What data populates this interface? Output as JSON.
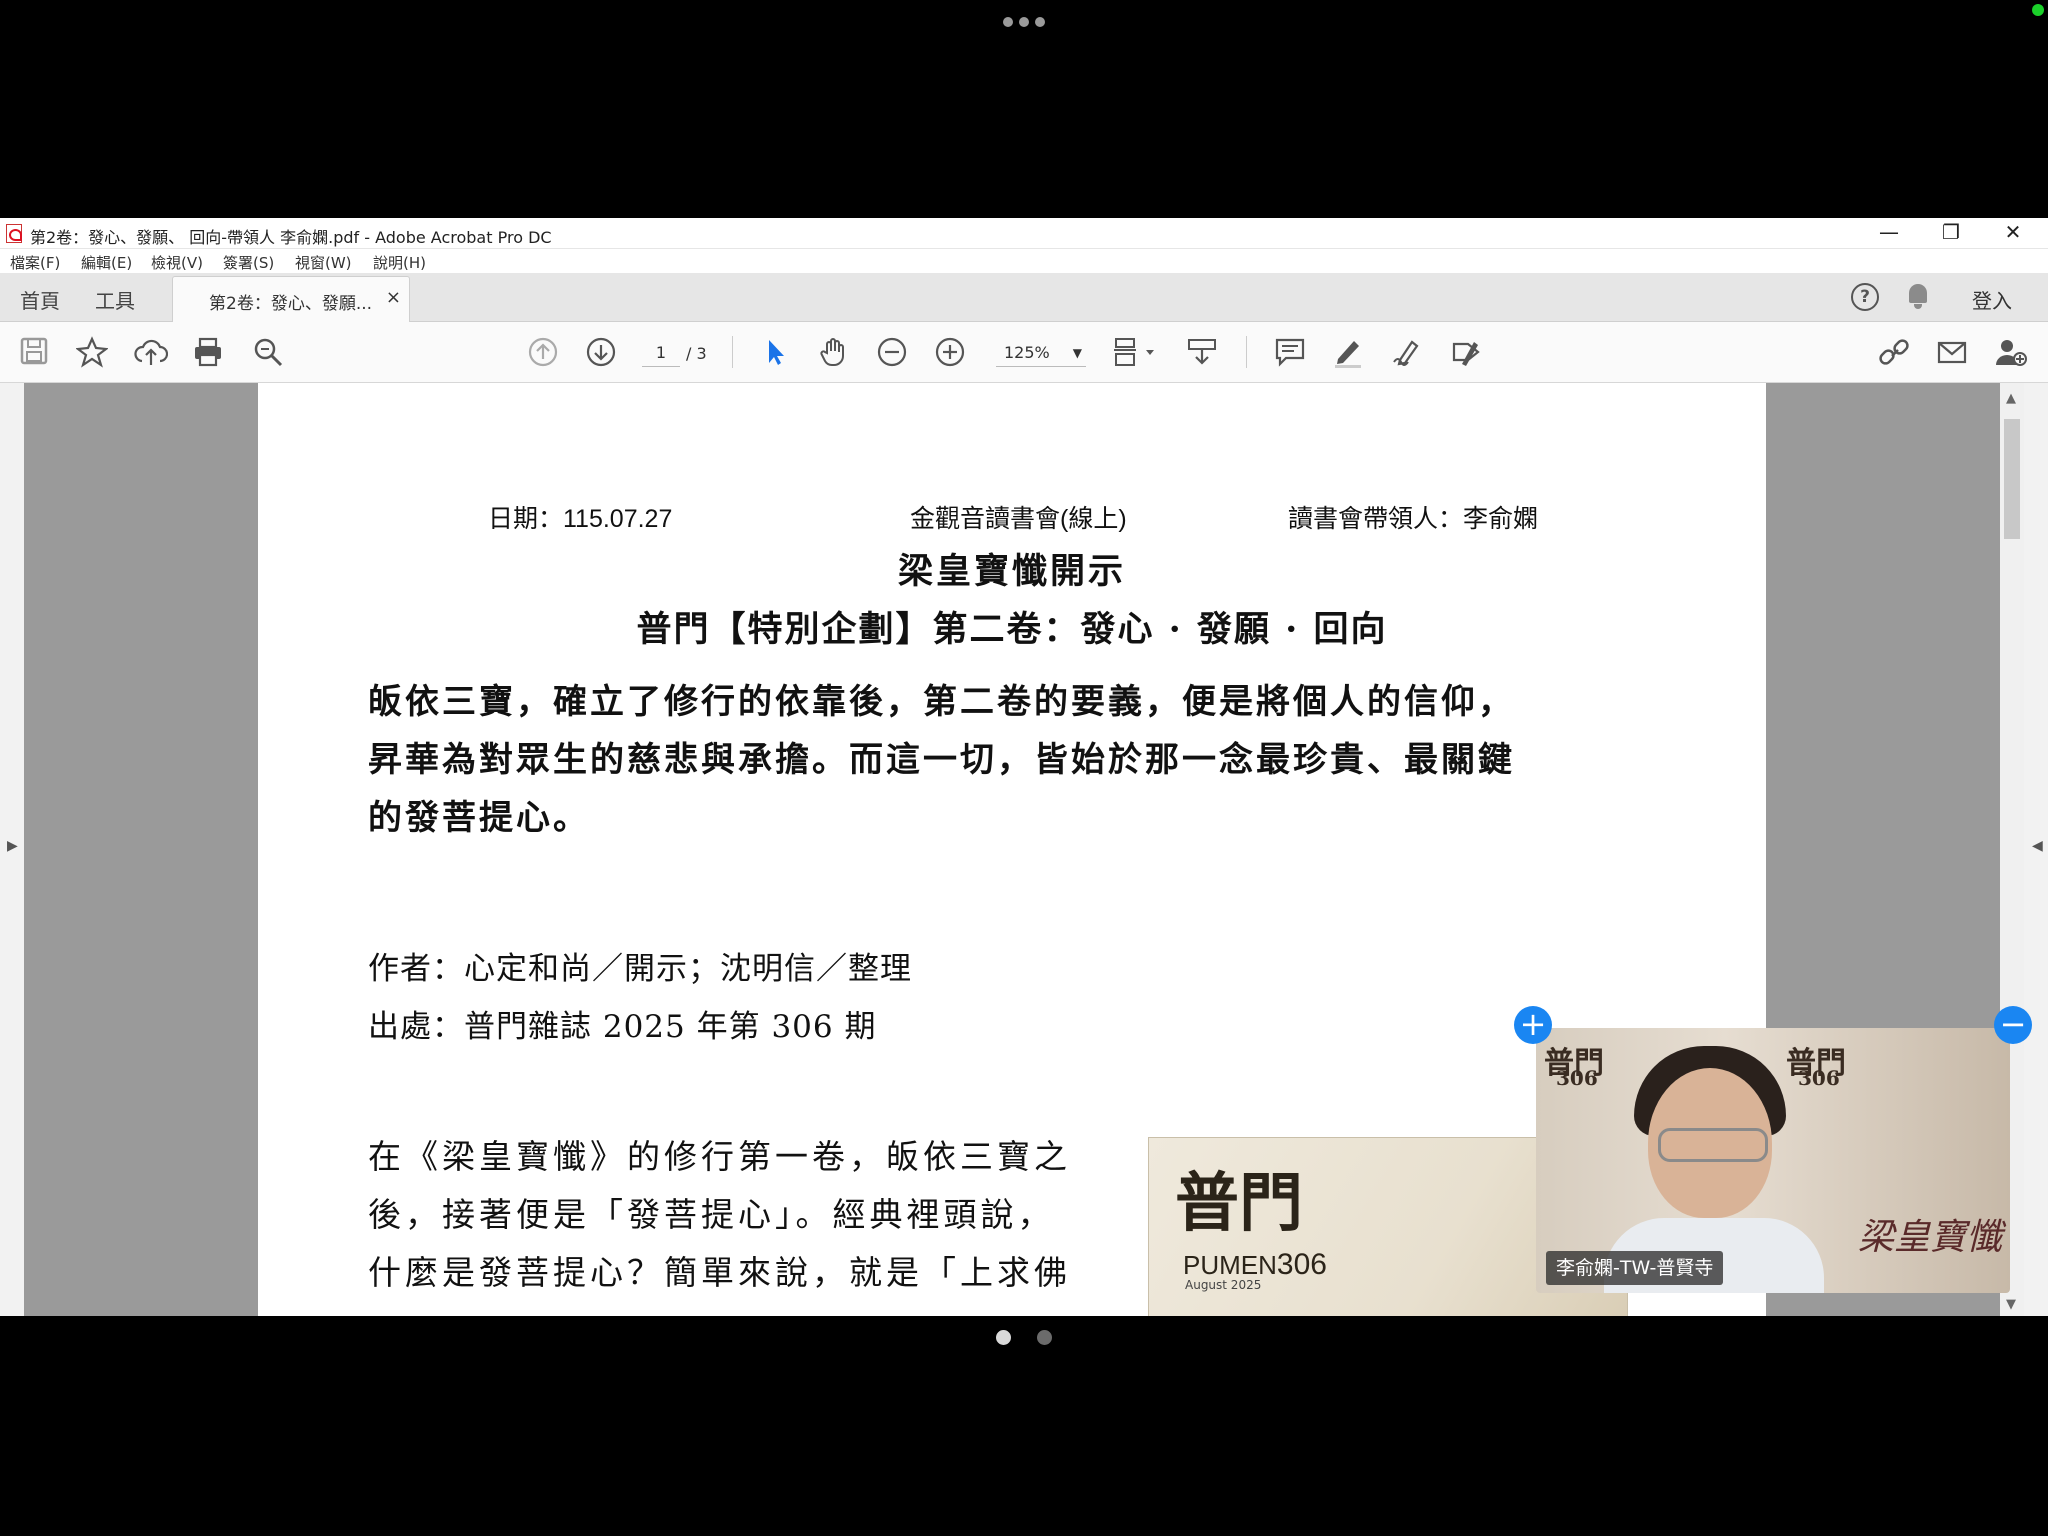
{
  "window": {
    "title": "第2卷：發心、發願、 回向-帶領人 李俞嫻.pdf - Adobe Acrobat Pro DC",
    "minimize": "—",
    "restore": "❐",
    "close": "✕"
  },
  "menu": [
    "檔案(F)",
    "編輯(E)",
    "檢視(V)",
    "簽署(S)",
    "視窗(W)",
    "說明(H)"
  ],
  "tabs": {
    "home": "首頁",
    "tools": "工具",
    "document": "第2卷：發心、發願...",
    "close": "×",
    "help": "?",
    "login": "登入"
  },
  "toolbar": {
    "current_page": "1",
    "total_pages": "/ 3",
    "zoom": "125%"
  },
  "document": {
    "date": "日期：115.07.27",
    "event": "金觀音讀書會(線上)",
    "leader": "讀書會帶領人：李俞嫻",
    "title1": "梁皇寶懺開示",
    "title2": "普門【特別企劃】第二卷：發心 · 發願 · 回向",
    "lead_line1": "皈依三寶，確立了修行的依靠後，第二卷的要義，便是將個人的信仰，",
    "lead_line2": "昇華為對眾生的慈悲與承擔。而這一切，皆始於那一念最珍貴、最關鍵",
    "lead_line3": "的發菩提心。",
    "author": "作者：心定和尚／開示；沈明信／整理",
    "source": "出處：普門雜誌 2025 年第 306 期",
    "body_line1": "在《梁皇寶懺》的修行第一卷，皈依三寶之",
    "body_line2": "後，接著便是「發菩提心」。經典裡頭說，",
    "body_line3": "什麼是發菩提心？簡單來說，就是「上求佛",
    "magazine_logo": "普門",
    "magazine_name": "PUMEN",
    "magazine_issue": "306",
    "magazine_date": "August 2025"
  },
  "video": {
    "participant_name": "李俞嫻-TW-普賢寺",
    "add_button": "+",
    "remove_button": "−",
    "cover_text": "普門",
    "cover_issue": "306",
    "calligraphy": "梁皇寶懺"
  },
  "colors": {
    "accent": "#1a86f2",
    "page_active_dot": "#d9d9d9",
    "page_inactive_dot": "#6b6b6b"
  }
}
